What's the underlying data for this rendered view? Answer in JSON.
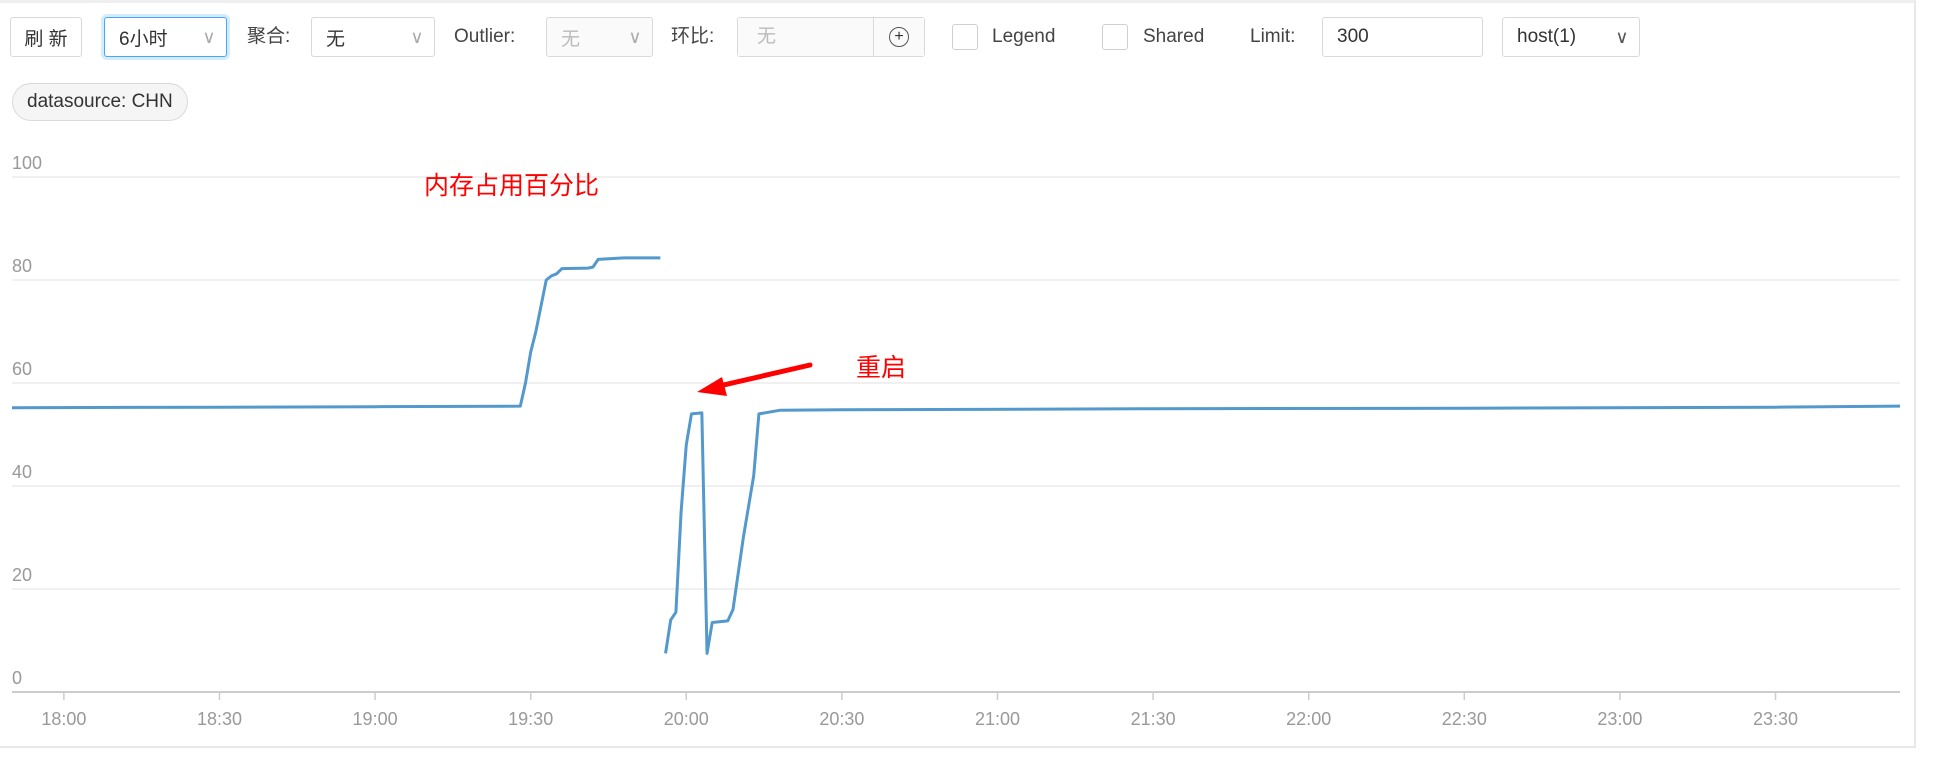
{
  "toolbar": {
    "refresh_label": "刷 新",
    "time_range": "6小时",
    "aggregate_label": "聚合:",
    "aggregate_value": "无",
    "outlier_label": "Outlier:",
    "outlier_value": "无",
    "compare_label": "环比:",
    "compare_placeholder": "无",
    "legend_label": "Legend",
    "legend_checked": false,
    "shared_label": "Shared",
    "shared_checked": false,
    "limit_label": "Limit:",
    "limit_value": "300",
    "host_value": "host(1)",
    "chevron_icon": "chevron-down-icon",
    "add_icon": "plus-circle-icon"
  },
  "filter_tag": "datasource: CHN",
  "annotations": {
    "title": "内存占用百分比",
    "restart": "重启",
    "color": "#ff0000"
  },
  "chart_data": {
    "type": "line",
    "ylim": [
      0,
      100
    ],
    "yticks": [
      "0",
      "20",
      "40",
      "60",
      "80",
      "100"
    ],
    "xticks": [
      "18:00",
      "18:30",
      "19:00",
      "19:30",
      "20:00",
      "20:30",
      "21:00",
      "21:30",
      "22:00",
      "22:30",
      "23:00",
      "23:30"
    ],
    "xlim": [
      "17:50",
      "23:54"
    ],
    "grid": true,
    "color": "#5499cc",
    "segments": [
      [
        [
          "17:50",
          55.2
        ],
        [
          "18:30",
          55.3
        ],
        [
          "19:00",
          55.4
        ],
        [
          "19:28",
          55.5
        ],
        [
          "19:29",
          60
        ],
        [
          "19:30",
          66
        ],
        [
          "19:31",
          70
        ],
        [
          "19:32",
          75
        ],
        [
          "19:33",
          80
        ],
        [
          "19:34",
          80.8
        ],
        [
          "19:35",
          81.2
        ],
        [
          "19:36",
          82.2
        ],
        [
          "19:41",
          82.3
        ],
        [
          "19:42",
          82.5
        ],
        [
          "19:43",
          84
        ],
        [
          "19:48",
          84.3
        ],
        [
          "19:55",
          84.3
        ]
      ],
      [
        [
          "19:56",
          7.5
        ],
        [
          "19:57",
          14
        ],
        [
          "19:58",
          15.5
        ],
        [
          "19:59",
          35
        ],
        [
          "20:00",
          48
        ],
        [
          "20:01",
          54
        ],
        [
          "20:03",
          54.2
        ],
        [
          "20:04",
          7.5
        ],
        [
          "20:05",
          13.5
        ],
        [
          "20:08",
          13.8
        ],
        [
          "20:09",
          16
        ],
        [
          "20:11",
          30
        ],
        [
          "20:13",
          42
        ],
        [
          "20:14",
          54
        ],
        [
          "20:18",
          54.7
        ],
        [
          "20:30",
          54.8
        ],
        [
          "21:30",
          55
        ],
        [
          "22:30",
          55.1
        ],
        [
          "23:30",
          55.3
        ],
        [
          "23:54",
          55.5
        ]
      ]
    ]
  }
}
